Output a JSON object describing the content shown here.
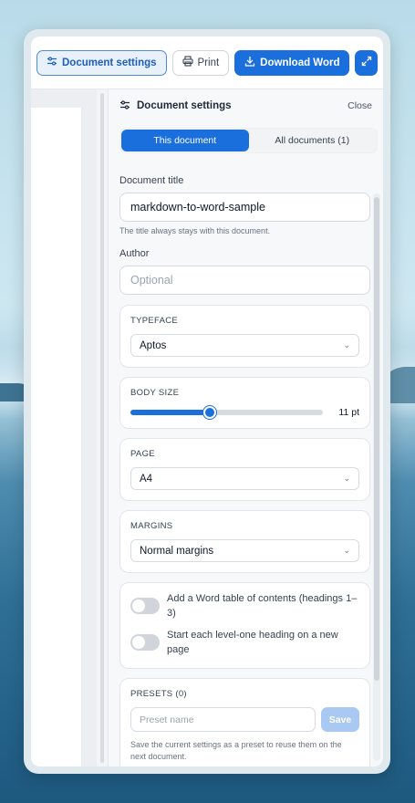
{
  "toolbar": {
    "settings_label": "Document settings",
    "print_label": "Print",
    "download_label": "Download Word"
  },
  "panel": {
    "title": "Document settings",
    "close_label": "Close",
    "tabs": [
      {
        "label": "This document",
        "active": true
      },
      {
        "label": "All documents (1)",
        "active": false
      }
    ],
    "doc_title": {
      "label": "Document title",
      "value": "markdown-to-word-sample",
      "help": "The title always stays with this document."
    },
    "author": {
      "label": "Author",
      "placeholder": "Optional"
    },
    "typeface": {
      "title": "TYPEFACE",
      "value": "Aptos"
    },
    "body_size": {
      "title": "BODY SIZE",
      "value_label": "11 pt",
      "fraction": 0.41
    },
    "page": {
      "title": "PAGE",
      "value": "A4"
    },
    "margins": {
      "title": "MARGINS",
      "value": "Normal margins"
    },
    "toggles": [
      {
        "label": "Add a Word table of contents (headings 1–3)",
        "on": false
      },
      {
        "label": "Start each level-one heading on a new page",
        "on": false
      }
    ],
    "presets": {
      "title": "PRESETS (0)",
      "placeholder": "Preset name",
      "save_label": "Save",
      "help": "Save the current settings as a preset to reuse them on the next document."
    }
  },
  "colors": {
    "accent": "#1a6fdc"
  }
}
